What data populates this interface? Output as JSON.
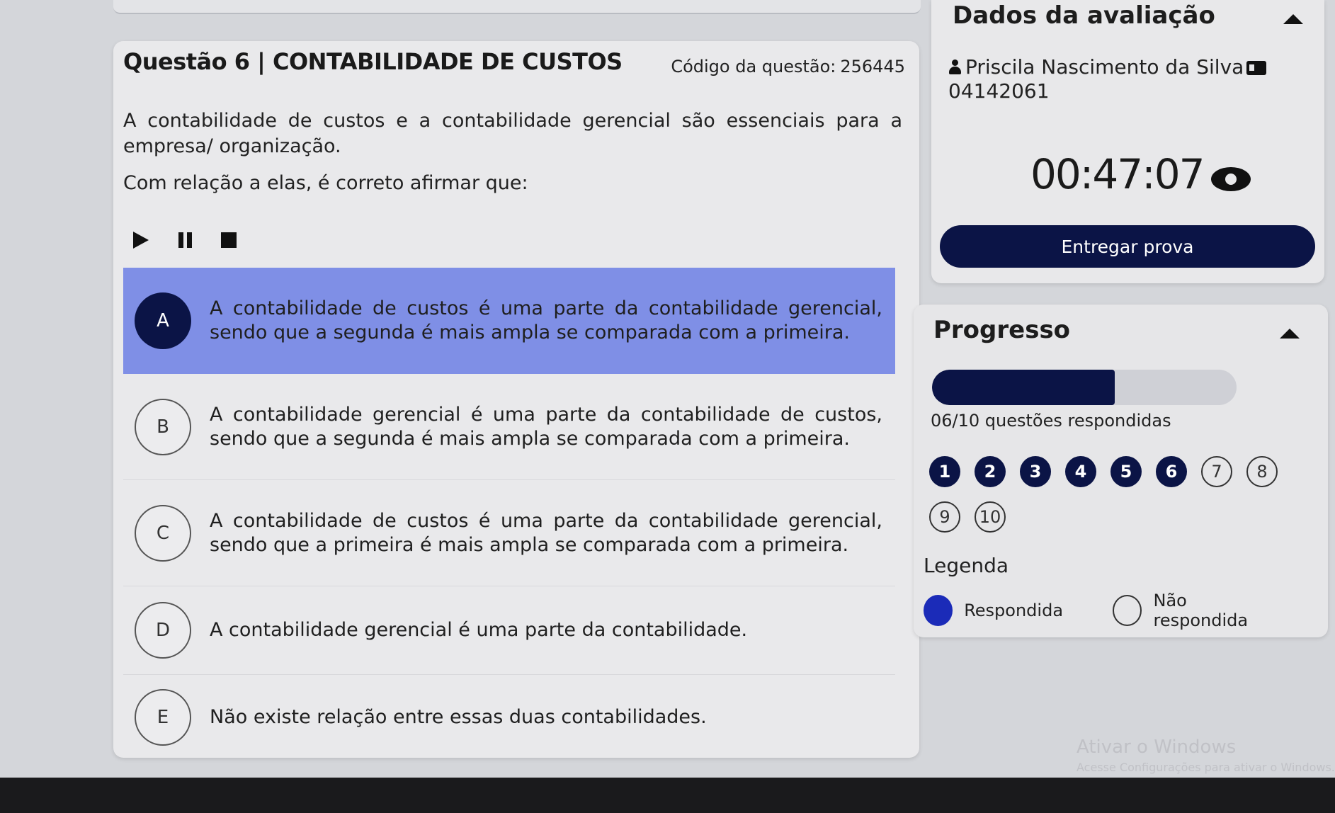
{
  "question": {
    "title": "Questão 6 | CONTABILIDADE DE CUSTOS",
    "code_label": "Código da questão:",
    "code_value": "256445",
    "statement": "A contabilidade de custos e a contabilidade gerencial são essenciais para a empresa/ organização.",
    "prompt": "Com relação a elas, é correto afirmar que:"
  },
  "player": [
    "play-icon",
    "pause-icon",
    "stop-icon"
  ],
  "options": [
    {
      "letter": "A",
      "text": "A contabilidade de custos é uma parte da contabilidade gerencial, sendo que a segunda é mais ampla se comparada com a primeira.",
      "selected": true
    },
    {
      "letter": "B",
      "text": "A contabilidade gerencial é uma parte da contabilidade de custos, sendo que a segunda é mais ampla se comparada com a primeira.",
      "selected": false
    },
    {
      "letter": "C",
      "text": "A contabilidade de custos é uma parte da contabilidade gerencial, sendo que a primeira é mais ampla se comparada com a primeira.",
      "selected": false
    },
    {
      "letter": "D",
      "text": "A contabilidade gerencial é uma parte da contabilidade.",
      "selected": false
    },
    {
      "letter": "E",
      "text": "Não existe relação entre essas duas contabilidades.",
      "selected": false
    }
  ],
  "assessment": {
    "title": "Dados da avaliação",
    "student_name": "Priscila Nascimento da Silva",
    "student_id": "04142061",
    "timer": "00:47:07",
    "submit_label": "Entregar prova"
  },
  "progress": {
    "title": "Progresso",
    "fraction": 0.6,
    "text": "06/10 questões respondidas",
    "questions": [
      {
        "n": "1",
        "answered": true
      },
      {
        "n": "2",
        "answered": true
      },
      {
        "n": "3",
        "answered": true
      },
      {
        "n": "4",
        "answered": true
      },
      {
        "n": "5",
        "answered": true
      },
      {
        "n": "6",
        "answered": true
      },
      {
        "n": "7",
        "answered": false
      },
      {
        "n": "8",
        "answered": false
      },
      {
        "n": "9",
        "answered": false
      },
      {
        "n": "10",
        "answered": false
      }
    ],
    "legend_title": "Legenda",
    "legend_answered": "Respondida",
    "legend_pending": "Não respondida"
  },
  "watermark": {
    "title": "Ativar o Windows",
    "subtitle": "Acesse Configurações para ativar o Windows."
  },
  "colors": {
    "primary": "#0b1446",
    "selected_option": "#7f8fe6",
    "legend_answered": "#1b2bb8"
  }
}
